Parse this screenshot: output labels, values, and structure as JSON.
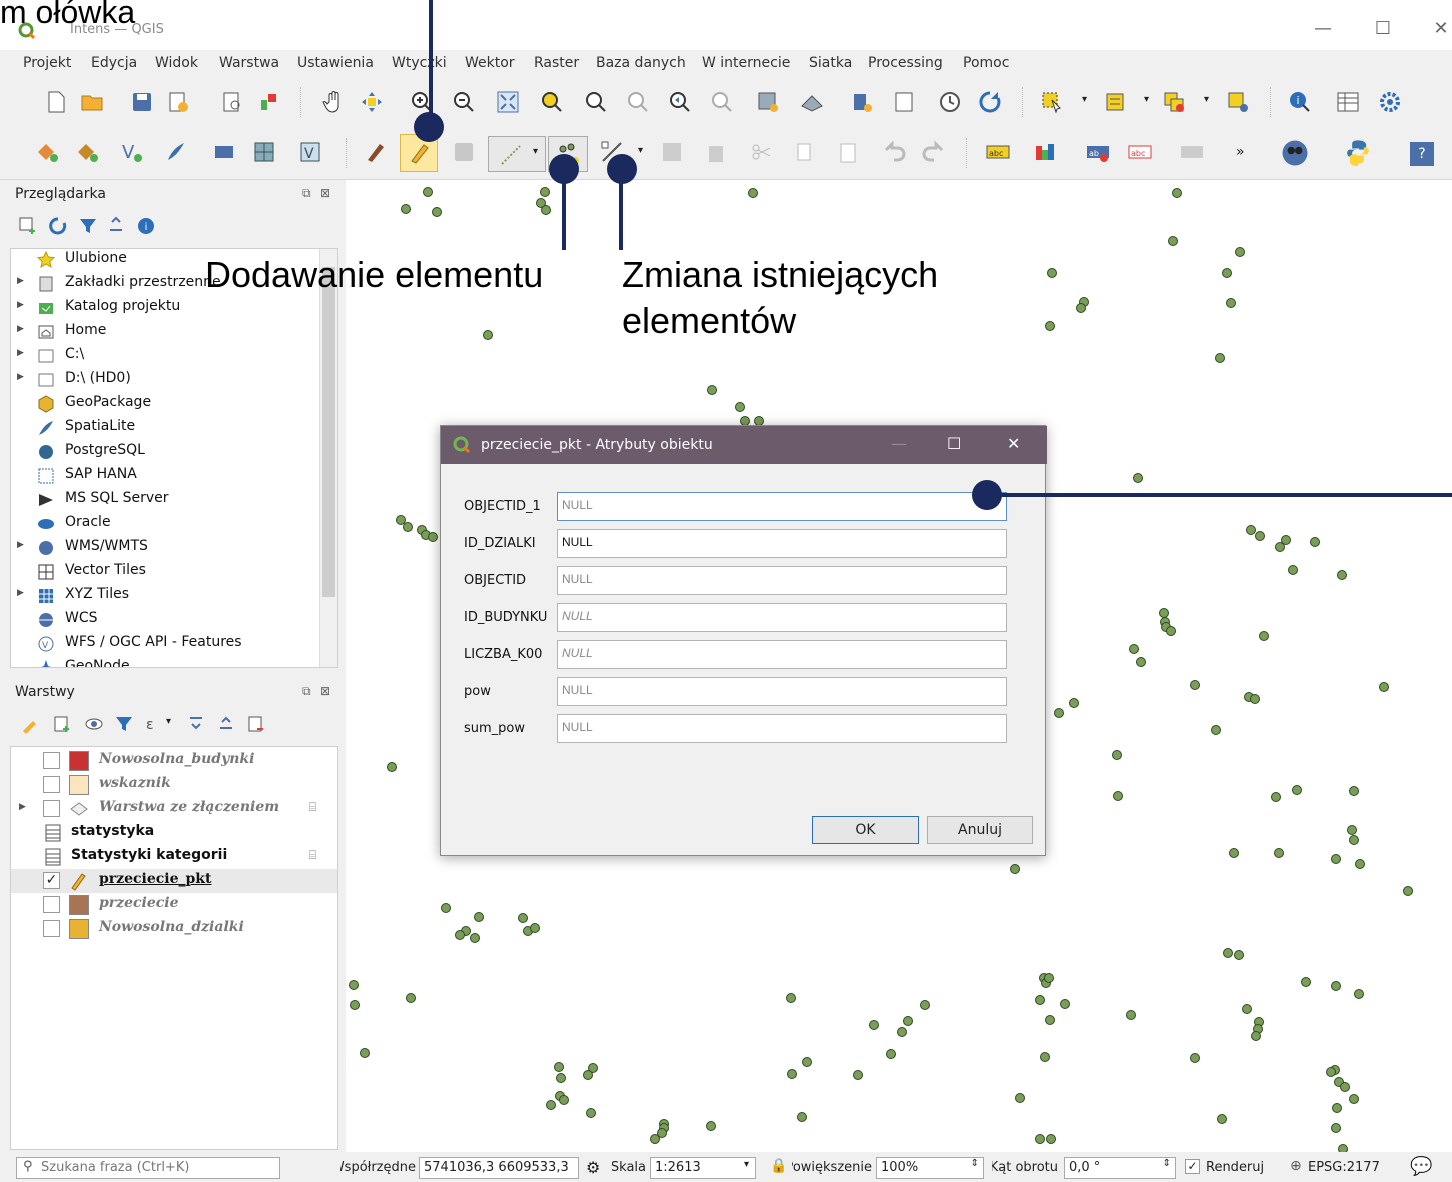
{
  "window": {
    "title": "Intens — QGIS"
  },
  "annotations": {
    "top_partial": "m ołówka",
    "add_feature": "Dodawanie elementu",
    "modify_line1": "Zmiana istniejących",
    "modify_line2": "elementów"
  },
  "menu": [
    "Projekt",
    "Edycja",
    "Widok",
    "Warstwa",
    "Ustawienia",
    "Wtyczki",
    "Wektor",
    "Raster",
    "Baza danych",
    "W internecie",
    "Siatka",
    "Processing",
    "Pomoc"
  ],
  "browser": {
    "title": "Przeglądarka",
    "items": [
      {
        "label": "Ulubione",
        "icon": "star-icon",
        "arrow": false
      },
      {
        "label": "Zakładki przestrzenne",
        "icon": "bookmark-icon",
        "arrow": true
      },
      {
        "label": "Katalog projektu",
        "icon": "project-folder-icon",
        "arrow": true
      },
      {
        "label": "Home",
        "icon": "home-folder-icon",
        "arrow": true
      },
      {
        "label": "C:\\",
        "icon": "folder-icon",
        "arrow": true
      },
      {
        "label": "D:\\ (HD0)",
        "icon": "folder-icon",
        "arrow": true
      },
      {
        "label": "GeoPackage",
        "icon": "geopackage-icon",
        "arrow": false
      },
      {
        "label": "SpatiaLite",
        "icon": "spatialite-icon",
        "arrow": false
      },
      {
        "label": "PostgreSQL",
        "icon": "postgresql-icon",
        "arrow": false
      },
      {
        "label": "SAP HANA",
        "icon": "sap-hana-icon",
        "arrow": false
      },
      {
        "label": "MS SQL Server",
        "icon": "mssql-icon",
        "arrow": false
      },
      {
        "label": "Oracle",
        "icon": "oracle-icon",
        "arrow": false
      },
      {
        "label": "WMS/WMTS",
        "icon": "wms-icon",
        "arrow": true
      },
      {
        "label": "Vector Tiles",
        "icon": "vector-tiles-icon",
        "arrow": false
      },
      {
        "label": "XYZ Tiles",
        "icon": "xyz-tiles-icon",
        "arrow": true
      },
      {
        "label": "WCS",
        "icon": "wcs-icon",
        "arrow": false
      },
      {
        "label": "WFS / OGC API - Features",
        "icon": "wfs-icon",
        "arrow": false
      },
      {
        "label": "GeoNode",
        "icon": "geonode-icon",
        "arrow": false
      }
    ]
  },
  "layers": {
    "title": "Warstwy",
    "items": [
      {
        "label": "Nowosolna_budynki",
        "style": "italic",
        "checked": false,
        "swatch": "#c83232"
      },
      {
        "label": "wskaznik",
        "style": "italic",
        "checked": false,
        "swatch": "#fbe5c0"
      },
      {
        "label": "Warstwa ze złączeniem",
        "style": "italic",
        "checked": false,
        "swatch": "none",
        "arrow": true
      },
      {
        "label": "statystyka",
        "style": "bold",
        "checked": null,
        "swatch": "table"
      },
      {
        "label": "Statystyki kategorii",
        "style": "bold",
        "checked": null,
        "swatch": "table"
      },
      {
        "label": "przeciecie_pkt",
        "style": "bold-underline",
        "checked": true,
        "swatch": "pencil"
      },
      {
        "label": "przeciecie",
        "style": "italic",
        "checked": false,
        "swatch": "#a97454"
      },
      {
        "label": "Nowosolna_dzialki",
        "style": "italic",
        "checked": false,
        "swatch": "#e8b233"
      }
    ]
  },
  "dialog": {
    "title": "przeciecie_pkt - Atrybuty obiektu",
    "fields": [
      {
        "label": "OBJECTID_1",
        "value": "NULL",
        "style": "gray"
      },
      {
        "label": "ID_DZIALKI",
        "value": "NULL",
        "style": "black"
      },
      {
        "label": "OBJECTID",
        "value": "NULL",
        "style": "gray"
      },
      {
        "label": "ID_BUDYNKU",
        "value": "NULL",
        "style": "italic"
      },
      {
        "label": "LICZBA_K00",
        "value": "NULL",
        "style": "italic"
      },
      {
        "label": "pow",
        "value": "NULL",
        "style": "gray"
      },
      {
        "label": "sum_pow",
        "value": "NULL",
        "style": "gray"
      }
    ],
    "ok_label": "OK",
    "cancel_label": "Anuluj"
  },
  "status": {
    "search_placeholder": "Szukana fraza (Ctrl+K)",
    "coord_label": "Współrzędne",
    "coord_value": "5741036,3 6609533,3",
    "scale_label": "Skala",
    "scale_value": "1:2613",
    "magnifier_label": "Powiększenie",
    "magnifier_value": "100%",
    "rotation_label": "Kąt obrotu",
    "rotation_value": "0,0 °",
    "render_label": "Renderuj",
    "crs_label": "EPSG:2177"
  },
  "colors": {
    "point_fill": "#7a9d59",
    "dialog_title_bg": "#6c5b6b",
    "annotation": "#1a2a5e"
  }
}
